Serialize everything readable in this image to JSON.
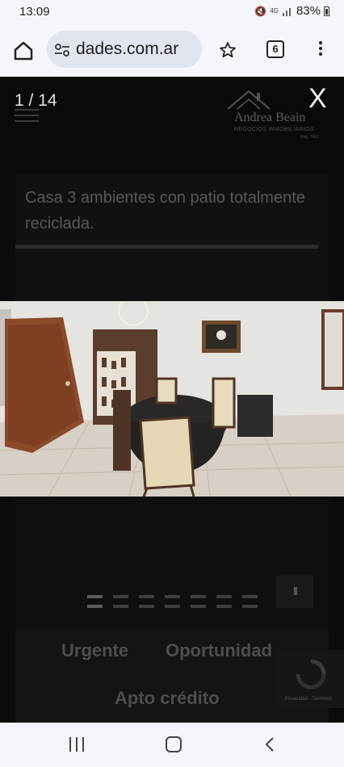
{
  "status_bar": {
    "time": "13:09",
    "network": "4G",
    "battery": "83%",
    "icons": [
      "mute-icon",
      "signal-icon",
      "battery-icon"
    ]
  },
  "browser": {
    "url": "dades.com.ar",
    "tab_count": "6",
    "icons": [
      "home-icon",
      "site-settings-icon",
      "bookmark-star-icon",
      "tabs-icon",
      "more-menu-icon"
    ]
  },
  "site": {
    "logo": {
      "name": "Andrea Beain",
      "tagline": "NEGOCIOS INMOBILIARIOS",
      "small": "Reg. 7416"
    }
  },
  "lightbox": {
    "counter": "1 / 14",
    "close_label": "X",
    "slide_count": 7,
    "active_slide": 0,
    "pause_label": "II"
  },
  "listing": {
    "title": "Casa 3 ambientes con patio totalmente reciclada.",
    "tags": [
      "Urgente",
      "Oportunidad",
      "Apto crédito"
    ]
  },
  "recaptcha": {
    "links": "Privacidad - Términos"
  },
  "nav_bar": {
    "icons": [
      "recent-apps-icon",
      "home-icon",
      "back-icon"
    ]
  },
  "colors": {
    "chrome_bg": "#f4f6fb",
    "address_bg": "#e1e5ee",
    "overlay_bg": "#0b0b0b"
  }
}
